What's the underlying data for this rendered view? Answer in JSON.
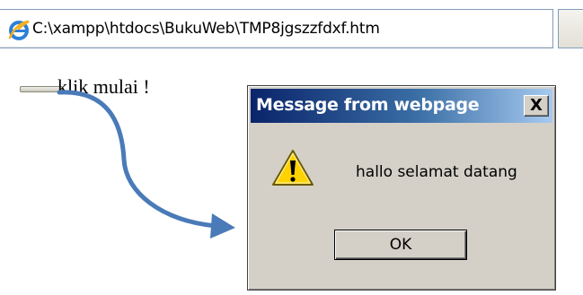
{
  "address_bar": {
    "url": "C:\\xampp\\htdocs\\BukuWeb\\TMP8jgszzfdxf.htm",
    "icon": "internet-explorer-icon"
  },
  "page": {
    "text": "klik mulai !"
  },
  "dialog": {
    "title": "Message from webpage",
    "close_label": "X",
    "message": "hallo selamat datang",
    "ok_label": "OK",
    "icon": "warning-icon"
  },
  "annotation": {
    "icon": "curved-arrow-icon",
    "color": "#4a7ab8"
  },
  "colors": {
    "titlebar_start": "#0a246a",
    "titlebar_end": "#a6caf0",
    "dialog_face": "#d4d0c8",
    "warning_yellow": "#ffd200"
  }
}
